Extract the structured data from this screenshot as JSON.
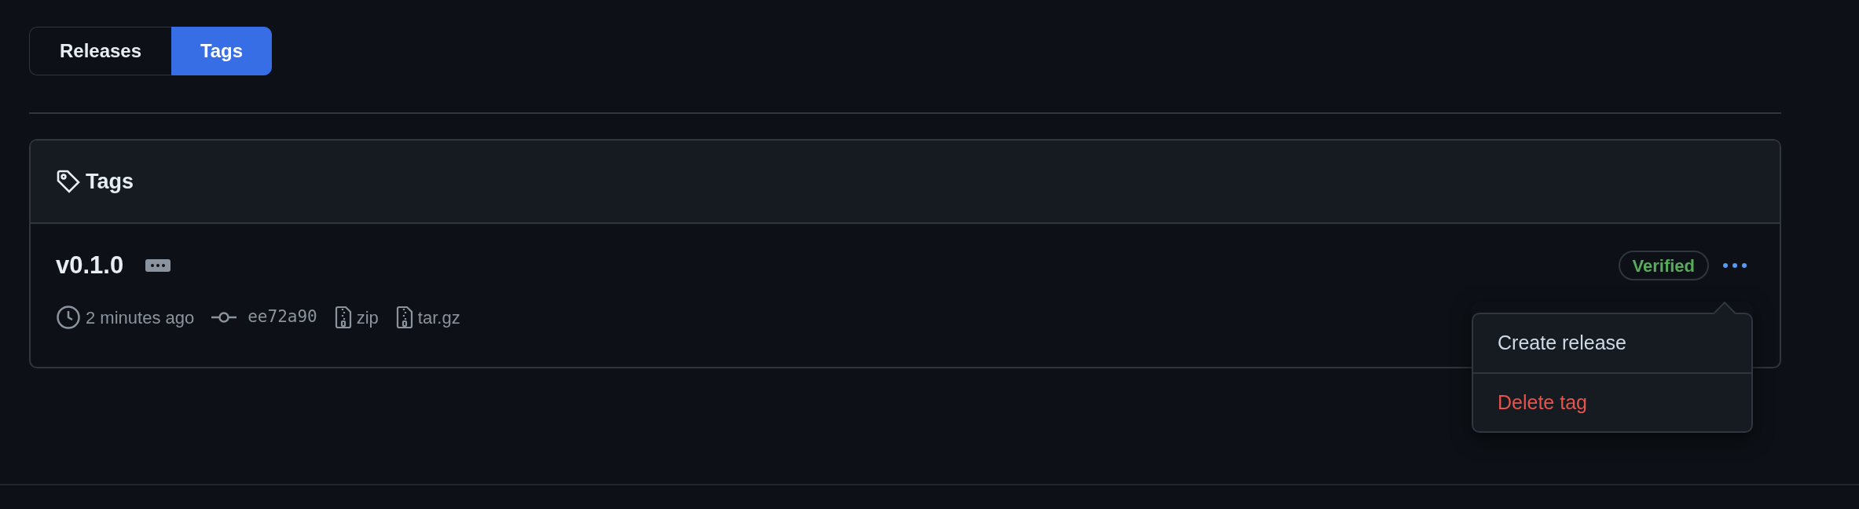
{
  "tabs": [
    {
      "label": "Releases",
      "selected": false
    },
    {
      "label": "Tags",
      "selected": true
    }
  ],
  "card": {
    "title": "Tags",
    "tags": [
      {
        "name": "v0.1.0",
        "time": "2 minutes ago",
        "commit": "ee72a90",
        "downloads": [
          "zip",
          "tar.gz"
        ],
        "verified": true,
        "badge": "Verified",
        "menu_open": true
      }
    ]
  },
  "menu": {
    "items": [
      {
        "label": "Create release",
        "kind": "normal"
      },
      {
        "label": "Delete tag",
        "kind": "danger"
      }
    ]
  }
}
